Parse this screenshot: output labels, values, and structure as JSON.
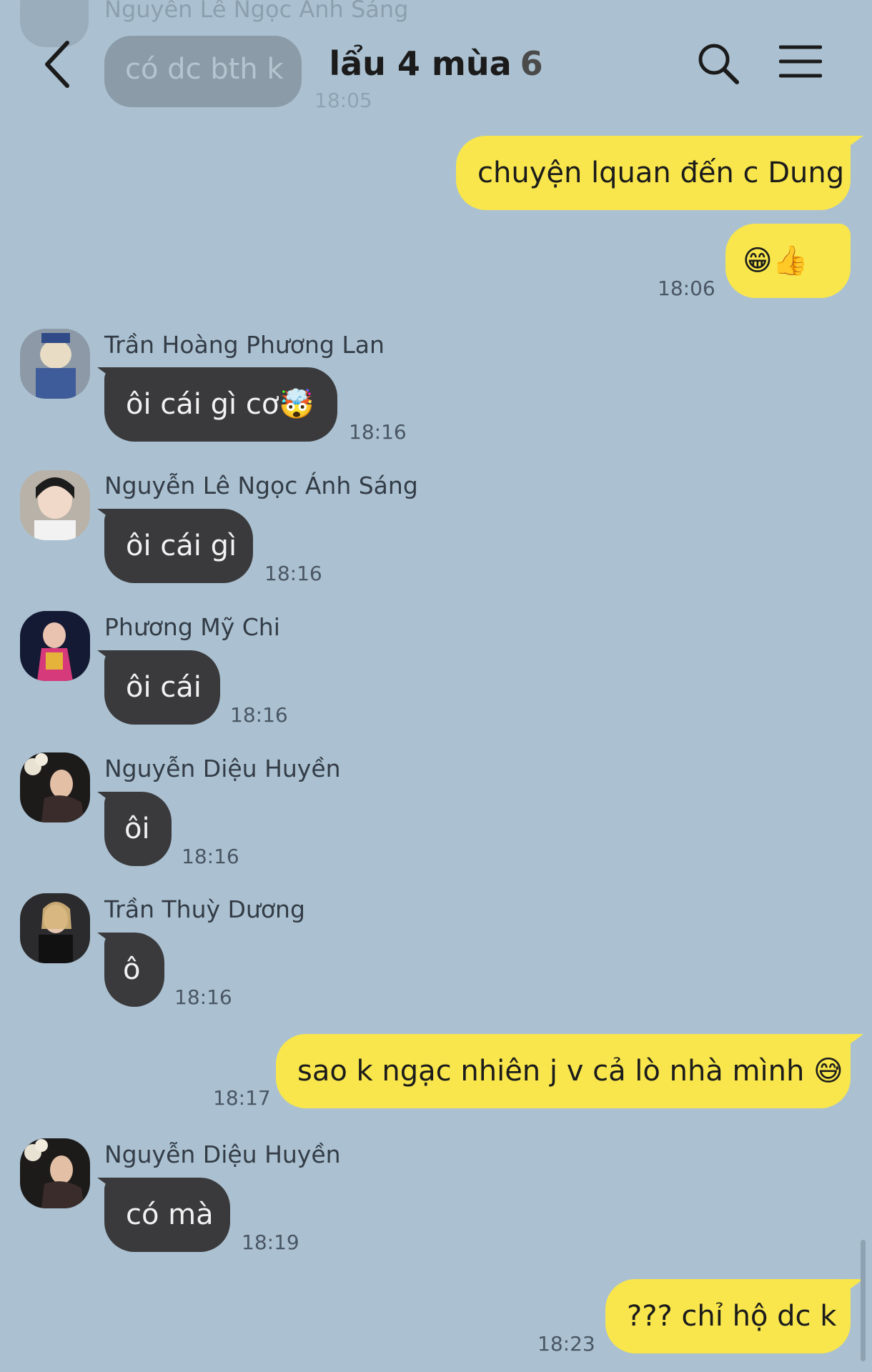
{
  "header": {
    "title": "lẩu 4 mùa",
    "member_count": "6"
  },
  "faded_message": {
    "sender": "Nguyễn Lê Ngọc Ánh Sáng",
    "text": "có dc bth k",
    "time": "18:05"
  },
  "messages": [
    {
      "from": "me",
      "text": "chuyện lquan đến c Dung",
      "time": ""
    },
    {
      "from": "me",
      "text": "😁👍",
      "time": "18:06"
    },
    {
      "from": "them",
      "sender": "Trần Hoàng Phương Lan",
      "text": "ôi cái gì cơ🤯",
      "time": "18:16",
      "avatar": "avatar-phuong-lan"
    },
    {
      "from": "them",
      "sender": "Nguyễn Lê Ngọc Ánh Sáng",
      "text": "ôi cái gì",
      "time": "18:16",
      "avatar": "avatar-anh-sang"
    },
    {
      "from": "them",
      "sender": "Phương Mỹ Chi",
      "text": "ôi cái",
      "time": "18:16",
      "avatar": "avatar-my-chi"
    },
    {
      "from": "them",
      "sender": "Nguyễn Diệu Huyền",
      "text": "ôi",
      "time": "18:16",
      "avatar": "avatar-dieu-huyen"
    },
    {
      "from": "them",
      "sender": "Trần Thuỳ Dương",
      "text": "ô",
      "time": "18:16",
      "avatar": "avatar-thuy-duong"
    },
    {
      "from": "me",
      "text": "sao k ngạc nhiên j v cả lò nhà mình 😅",
      "time": "18:17"
    },
    {
      "from": "them",
      "sender": "Nguyễn Diệu Huyền",
      "text": "có mà",
      "time": "18:19",
      "avatar": "avatar-dieu-huyen"
    },
    {
      "from": "me",
      "text": "??? chỉ hộ dc k",
      "time": "18:23"
    }
  ],
  "icons": {
    "back": "chevron-left-icon",
    "search": "search-icon",
    "menu": "hamburger-menu-icon"
  },
  "colors": {
    "background": "#abc1d1",
    "my_bubble": "#f8e64c",
    "their_bubble": "#3a3a3c"
  }
}
